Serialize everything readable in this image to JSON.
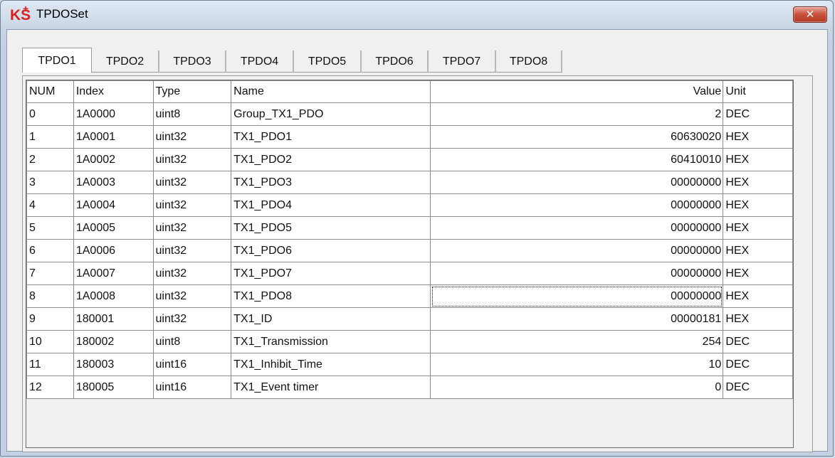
{
  "window": {
    "title": "TPDOSet",
    "logo_text": "KS",
    "logo_plus": "+",
    "close_glyph": "✕"
  },
  "tabs": [
    "TPDO1",
    "TPDO2",
    "TPDO3",
    "TPDO4",
    "TPDO5",
    "TPDO6",
    "TPDO7",
    "TPDO8"
  ],
  "active_tab": "TPDO1",
  "table": {
    "columns": [
      "NUM",
      "Index",
      "Type",
      "Name",
      "Value",
      "Unit"
    ],
    "rows": [
      [
        "0",
        "1A0000",
        "uint8",
        "Group_TX1_PDO",
        "2",
        "DEC"
      ],
      [
        "1",
        "1A0001",
        "uint32",
        "TX1_PDO1",
        "60630020",
        "HEX"
      ],
      [
        "2",
        "1A0002",
        "uint32",
        "TX1_PDO2",
        "60410010",
        "HEX"
      ],
      [
        "3",
        "1A0003",
        "uint32",
        "TX1_PDO3",
        "00000000",
        "HEX"
      ],
      [
        "4",
        "1A0004",
        "uint32",
        "TX1_PDO4",
        "00000000",
        "HEX"
      ],
      [
        "5",
        "1A0005",
        "uint32",
        "TX1_PDO5",
        "00000000",
        "HEX"
      ],
      [
        "6",
        "1A0006",
        "uint32",
        "TX1_PDO6",
        "00000000",
        "HEX"
      ],
      [
        "7",
        "1A0007",
        "uint32",
        "TX1_PDO7",
        "00000000",
        "HEX"
      ],
      [
        "8",
        "1A0008",
        "uint32",
        "TX1_PDO8",
        "00000000",
        "HEX"
      ],
      [
        "9",
        "180001",
        "uint32",
        "TX1_ID",
        "00000181",
        "HEX"
      ],
      [
        "10",
        "180002",
        "uint8",
        "TX1_Transmission",
        "254",
        "DEC"
      ],
      [
        "11",
        "180003",
        "uint16",
        "TX1_Inhibit_Time",
        "10",
        "DEC"
      ],
      [
        "12",
        "180005",
        "uint16",
        "TX1_Event timer",
        "0",
        "DEC"
      ]
    ],
    "focused_cell": {
      "row": 8,
      "column": "Value"
    }
  }
}
